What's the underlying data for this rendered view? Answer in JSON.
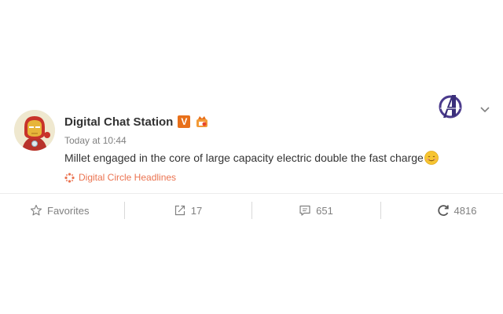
{
  "post": {
    "author": "Digital Chat Station",
    "verified_badge": "V",
    "timestamp": "Today at 10:44",
    "text": "Millet engaged in the core of large capacity electric double the fast charge",
    "source_label": "Digital Circle Headlines",
    "emoji_icon": "smile-emoji-icon",
    "avatar_icon": "iron-man-avatar-icon",
    "corner_logo_icon": "avengers-logo-icon"
  },
  "actions": {
    "favorites_label": "Favorites",
    "repost_count": "17",
    "comment_count": "651",
    "like_count": "4816"
  },
  "colors": {
    "text_primary": "#333333",
    "text_secondary": "#808080",
    "source_accent": "#eb7350",
    "badge_orange": "#e8701a",
    "divider": "#ececec"
  }
}
